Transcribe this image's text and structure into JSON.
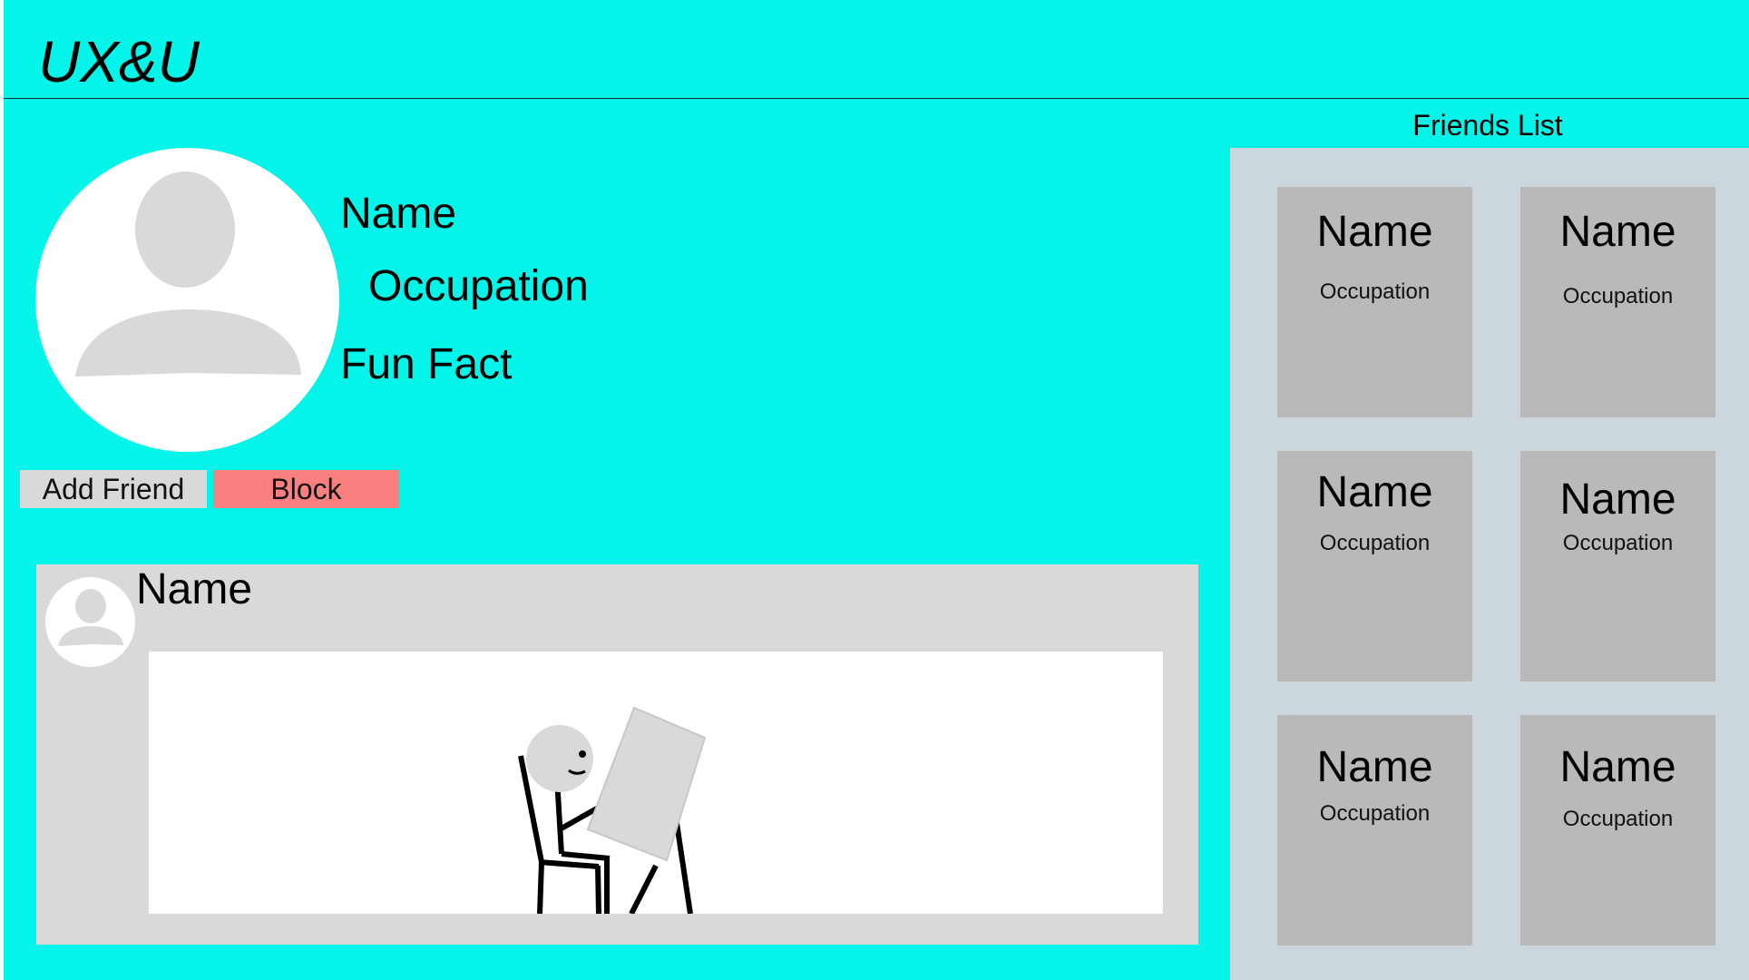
{
  "app": {
    "title": "UX&U"
  },
  "profile": {
    "name": "Name",
    "occupation": "Occupation",
    "fun_fact": "Fun Fact",
    "add_friend_label": "Add Friend",
    "block_label": "Block"
  },
  "post": {
    "author_name": "Name",
    "image_icon": "person-sitting-at-easel-illustration"
  },
  "friends": {
    "title": "Friends List",
    "items": [
      {
        "name": "Name",
        "occupation": "Occupation"
      },
      {
        "name": "Name",
        "occupation": "Occupation"
      },
      {
        "name": "Name",
        "occupation": "Occupation"
      },
      {
        "name": "Name",
        "occupation": "Occupation"
      },
      {
        "name": "Name",
        "occupation": "Occupation"
      },
      {
        "name": "Name",
        "occupation": "Occupation"
      }
    ]
  },
  "colors": {
    "background": "#03f5e9",
    "friends_panel": "#cbd6dd",
    "friend_card": "#b9b9b9",
    "post_card": "#d9d9d9",
    "add_friend_button": "#d9d9d9",
    "block_button": "#fa8080"
  }
}
